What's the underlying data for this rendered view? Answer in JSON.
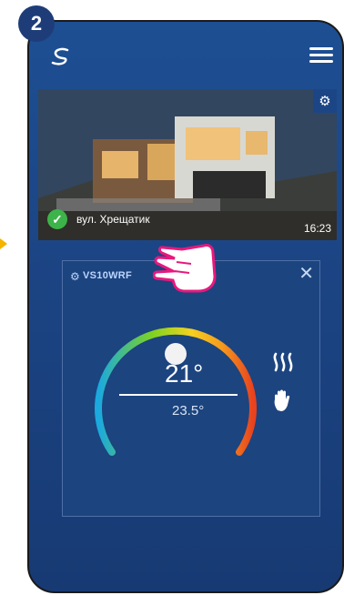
{
  "step_number": "2",
  "hero": {
    "location_label": "вул. Хрещатик",
    "time": "16:23"
  },
  "device": {
    "name": "VS10WRF",
    "setpoint": "21°",
    "current_temp": "23.5°",
    "mode_icons": [
      "heating-icon",
      "manual-mode-icon"
    ]
  },
  "colors": {
    "background": "#1c4585",
    "accent_green": "#3cb449",
    "step_badge": "#1e3d78",
    "hand_pointer": "#e8187d"
  }
}
